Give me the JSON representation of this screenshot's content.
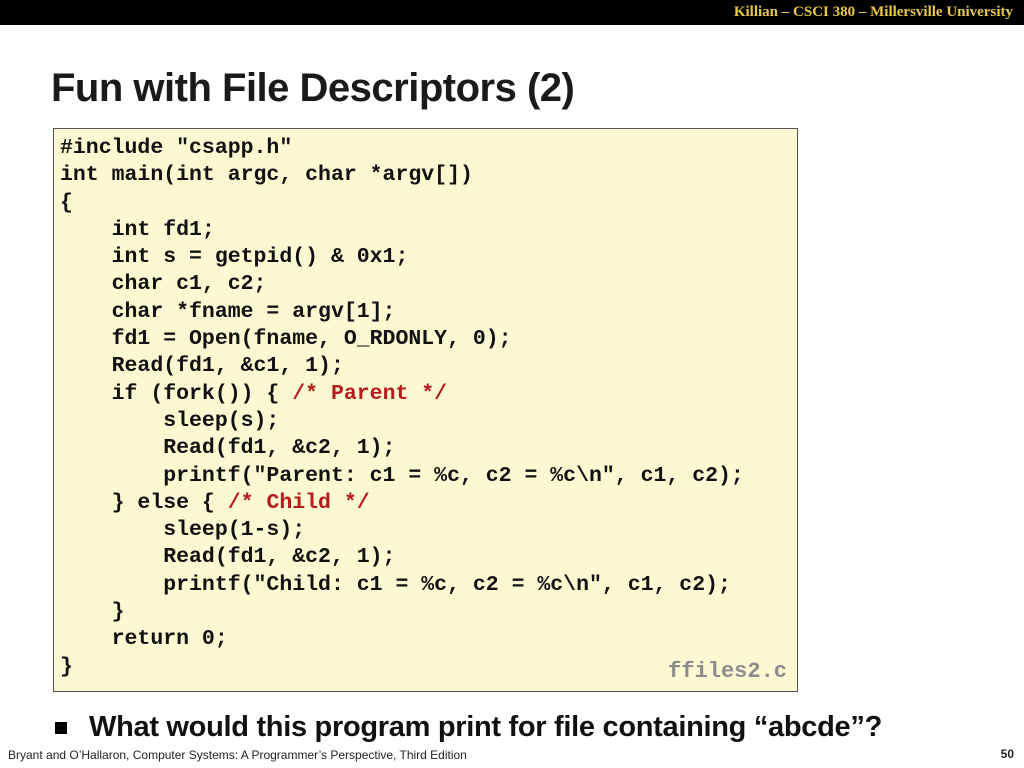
{
  "header": {
    "course_banner": "Killian – CSCI 380 – Millersville University"
  },
  "slide": {
    "title": "Fun with File Descriptors (2)"
  },
  "code": {
    "lines": [
      "#include \"csapp.h\"",
      "int main(int argc, char *argv[])",
      "{",
      "    int fd1;",
      "    int s = getpid() & 0x1;",
      "    char c1, c2;",
      "    char *fname = argv[1];",
      "    fd1 = Open(fname, O_RDONLY, 0);",
      "    Read(fd1, &c1, 1);",
      "    if (fork()) { ",
      "        sleep(s);",
      "        Read(fd1, &c2, 1);",
      "        printf(\"Parent: c1 = %c, c2 = %c\\n\", c1, c2);",
      "    } else { ",
      "        sleep(1-s);",
      "        Read(fd1, &c2, 1);",
      "        printf(\"Child: c1 = %c, c2 = %c\\n\", c1, c2);",
      "    }",
      "    return 0;",
      "}"
    ],
    "parent_comment": "/* Parent */",
    "child_comment": "/* Child */",
    "filename": "ffiles2.c",
    "comment_color": "#b71c1c",
    "background_color": "#fbf8d2"
  },
  "bullet": {
    "text": "What would this program print for file containing “abcde”?"
  },
  "footer": {
    "citation": "Bryant and O’Hallaron, Computer Systems: A Programmer’s Perspective, Third Edition",
    "page_number": "50"
  }
}
